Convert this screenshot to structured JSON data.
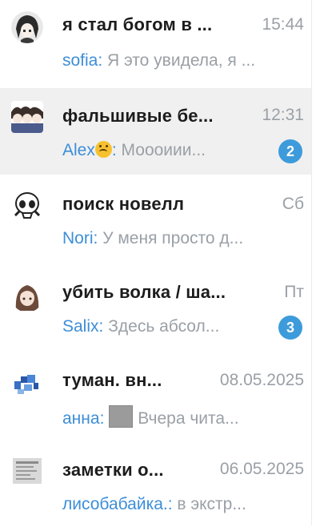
{
  "chats": [
    {
      "title": "я стал богом в ...",
      "time": "15:44",
      "sender": "sofia",
      "sender_emoji": "",
      "separator": ": ",
      "has_media": false,
      "preview": "Я это увидела, я ...",
      "unread": "",
      "avatar_icon": "anime-girl-avatar"
    },
    {
      "title": "фальшивые бе...",
      "time": "12:31",
      "sender": "Alex",
      "sender_emoji": "upside-down-face-emoji",
      "separator": ": ",
      "has_media": false,
      "preview": "Моооиии...",
      "unread": "2",
      "avatar_icon": "group-characters-avatar"
    },
    {
      "title": "поиск новелл",
      "time": "Сб",
      "sender": "Nori",
      "sender_emoji": "",
      "separator": ": ",
      "has_media": false,
      "preview": "У меня просто д...",
      "unread": "",
      "avatar_icon": "cartoon-skull-avatar"
    },
    {
      "title": "убить волка / ша...",
      "time": "Пт",
      "sender": "Salix",
      "sender_emoji": "",
      "separator": ": ",
      "has_media": false,
      "preview": "Здесь абсол...",
      "unread": "3",
      "avatar_icon": "brown-hair-girl-avatar"
    },
    {
      "title": "туман. вн...",
      "time": "08.05.2025",
      "sender": "анна",
      "sender_emoji": "",
      "separator": ": ",
      "has_media": true,
      "preview": "Вчера чита...",
      "unread": "",
      "avatar_icon": "blue-pixel-avatar"
    },
    {
      "title": "заметки о...",
      "time": "06.05.2025",
      "sender": "лисобабайка.",
      "sender_emoji": "",
      "separator": ": ",
      "has_media": false,
      "preview": "в экстр...",
      "unread": "",
      "avatar_icon": "document-scan-avatar"
    }
  ],
  "colors": {
    "sender": "#3d8ed8",
    "badge": "#3d9bdb",
    "selected_row": "#f0f0f0",
    "muted_text": "#9aa0a6"
  }
}
